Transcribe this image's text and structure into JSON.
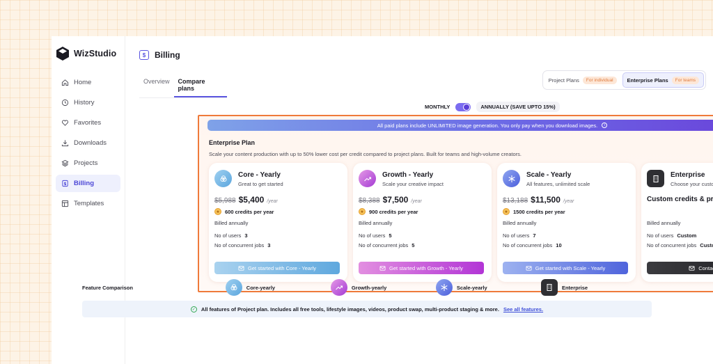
{
  "brand": {
    "name": "WizStudio"
  },
  "sidebar": {
    "items": [
      {
        "label": "Home",
        "icon": "home-icon"
      },
      {
        "label": "History",
        "icon": "clock-icon"
      },
      {
        "label": "Favorites",
        "icon": "heart-icon"
      },
      {
        "label": "Downloads",
        "icon": "download-icon"
      },
      {
        "label": "Projects",
        "icon": "layers-icon"
      },
      {
        "label": "Billing",
        "icon": "dollar-icon",
        "active": true
      },
      {
        "label": "Templates",
        "icon": "template-icon"
      }
    ]
  },
  "header": {
    "title": "Billing",
    "icon": "$"
  },
  "tabs": [
    {
      "label": "Overview"
    },
    {
      "label": "Compare plans",
      "active": true
    }
  ],
  "plan_switch": {
    "project": {
      "label": "Project Plans",
      "pill": "For individual"
    },
    "enterprise": {
      "label": "Enterprise Plans",
      "pill": "For teams",
      "selected": true
    }
  },
  "billing_cycle": {
    "monthly": "MONTHLY",
    "annually": "ANNUALLY (SAVE UPTO 15%)",
    "state": "annually"
  },
  "banner": {
    "text": "All paid plans include UNLIMITED image generation. You only pay when you download images.",
    "info": "i"
  },
  "enterprise": {
    "title": "Enterprise Plan",
    "description": "Scale your content production with up to 50% lower cost per credit compared to project plans. Built for teams and high-volume creators."
  },
  "cards": [
    {
      "name": "Core - Yearly",
      "tagline": "Great to get started",
      "old_price": "$5,988",
      "price": "$5,400",
      "per": "/year",
      "credits": "600 credits per year",
      "billed": "Billed annually",
      "users_label": "No of users",
      "users": "3",
      "jobs_label": "No of concurrent jobs",
      "jobs": "3",
      "button": "Get started with Core - Yearly",
      "color": "#6fb3e3"
    },
    {
      "name": "Growth - Yearly",
      "tagline": "Scale your creative impact",
      "old_price": "$8,388",
      "price": "$7,500",
      "per": "/year",
      "credits": "900 credits per year",
      "billed": "Billed annually",
      "users_label": "No of users",
      "users": "5",
      "jobs_label": "No of concurrent jobs",
      "jobs": "5",
      "button": "Get started with Growth - Yearly",
      "color": "#b93fd7"
    },
    {
      "name": "Scale - Yearly",
      "tagline": "All features, unlimited scale",
      "old_price": "$13,188",
      "price": "$11,500",
      "per": "/year",
      "credits": "1500 credits per year",
      "billed": "Billed annually",
      "users_label": "No of users",
      "users": "7",
      "jobs_label": "No of concurrent jobs",
      "jobs": "10",
      "button": "Get started with Scale - Yearly",
      "color": "#5a6fe0"
    },
    {
      "name": "Enterprise",
      "tagline": "Choose your custom plan",
      "custom_title": "Custom credits & pricing",
      "billed": "Billed annually",
      "users_label": "No of users",
      "users": "Custom",
      "jobs_label": "No of concurrent jobs",
      "jobs": "Custom",
      "button": "Contact sales",
      "color": "#2a2a2e"
    }
  ],
  "feature_comparison": {
    "title": "Feature Comparison",
    "columns": [
      {
        "label": "Core-yearly"
      },
      {
        "label": "Growth-yearly"
      },
      {
        "label": "Scale-yearly"
      },
      {
        "label": "Enterprise"
      }
    ]
  },
  "all_features": {
    "text": "All features of Project plan. Includes all free tools, lifestyle images, videos, product swap, multi-product staging & more.",
    "link": "See all features."
  }
}
